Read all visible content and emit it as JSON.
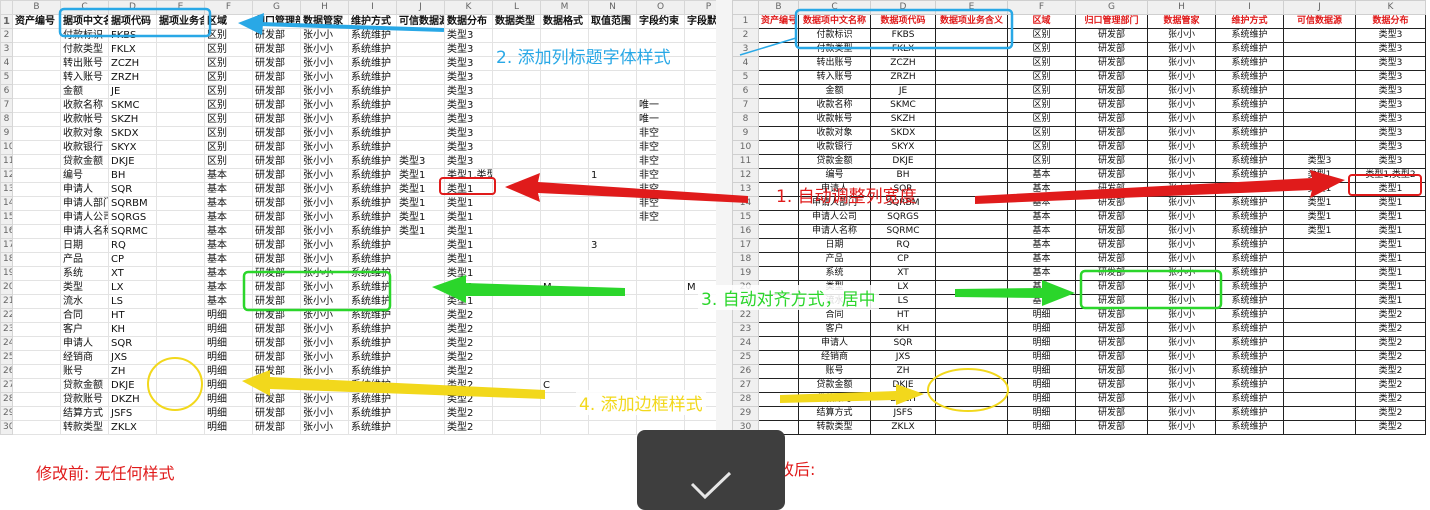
{
  "col_letters_before": [
    "",
    "B",
    "C",
    "D",
    "E",
    "F",
    "G",
    "H",
    "I",
    "J",
    "K",
    "L",
    "M",
    "N",
    "O",
    "P"
  ],
  "col_letters_after": [
    "",
    "B",
    "C",
    "D",
    "E",
    "F",
    "G",
    "H",
    "I",
    "J",
    "K"
  ],
  "headers_before": [
    "资产编号",
    "据项中文名",
    "据项代码",
    "据项业务含义",
    "区域",
    "归口管理部门",
    "数据管家",
    "维护方式",
    "可信数据源",
    "数据分布",
    "数据类型",
    "数据格式",
    "取值范围",
    "字段约束",
    "字段默认"
  ],
  "headers_after": [
    "资产编号",
    "数据项中文名称",
    "数据项代码",
    "数据项业务含义",
    "区域",
    "归口管理部门",
    "数据管家",
    "维护方式",
    "可信数据源",
    "数据分布"
  ],
  "rows": [
    [
      "",
      "付款标识",
      "FKBS",
      "",
      "区别",
      "研发部",
      "张小小",
      "系统维护",
      "",
      "类型3",
      "",
      "",
      "",
      "",
      ""
    ],
    [
      "",
      "付款类型",
      "FKLX",
      "",
      "区别",
      "研发部",
      "张小小",
      "系统维护",
      "",
      "类型3",
      "",
      "",
      "",
      "",
      ""
    ],
    [
      "",
      "转出账号",
      "ZCZH",
      "",
      "区别",
      "研发部",
      "张小小",
      "系统维护",
      "",
      "类型3",
      "",
      "",
      "",
      "",
      ""
    ],
    [
      "",
      "转入账号",
      "ZRZH",
      "",
      "区别",
      "研发部",
      "张小小",
      "系统维护",
      "",
      "类型3",
      "",
      "",
      "",
      "",
      ""
    ],
    [
      "",
      "金额",
      "JE",
      "",
      "区别",
      "研发部",
      "张小小",
      "系统维护",
      "",
      "类型3",
      "",
      "",
      "",
      "",
      ""
    ],
    [
      "",
      "收款名称",
      "SKMC",
      "",
      "区别",
      "研发部",
      "张小小",
      "系统维护",
      "",
      "类型3",
      "",
      "",
      "",
      "唯一",
      ""
    ],
    [
      "",
      "收款帐号",
      "SKZH",
      "",
      "区别",
      "研发部",
      "张小小",
      "系统维护",
      "",
      "类型3",
      "",
      "",
      "",
      "唯一",
      ""
    ],
    [
      "",
      "收款对象",
      "SKDX",
      "",
      "区别",
      "研发部",
      "张小小",
      "系统维护",
      "",
      "类型3",
      "",
      "",
      "",
      "非空",
      ""
    ],
    [
      "",
      "收款银行",
      "SKYX",
      "",
      "区别",
      "研发部",
      "张小小",
      "系统维护",
      "",
      "类型3",
      "",
      "",
      "",
      "非空",
      ""
    ],
    [
      "",
      "贷款金额",
      "DKJE",
      "",
      "区别",
      "研发部",
      "张小小",
      "系统维护",
      "类型3",
      "类型3",
      "",
      "",
      "",
      "非空",
      ""
    ],
    [
      "",
      "编号",
      "BH",
      "",
      "基本",
      "研发部",
      "张小小",
      "系统维护",
      "类型1",
      "类型1,类型2",
      "",
      "",
      "1",
      "非空",
      ""
    ],
    [
      "",
      "申请人",
      "SQR",
      "",
      "基本",
      "研发部",
      "张小小",
      "系统维护",
      "类型1",
      "类型1",
      "",
      "",
      "",
      "非空",
      ""
    ],
    [
      "",
      "申请人部门",
      "SQRBM",
      "",
      "基本",
      "研发部",
      "张小小",
      "系统维护",
      "类型1",
      "类型1",
      "",
      "",
      "",
      "非空",
      ""
    ],
    [
      "",
      "申请人公司",
      "SQRGS",
      "",
      "基本",
      "研发部",
      "张小小",
      "系统维护",
      "类型1",
      "类型1",
      "",
      "",
      "",
      "非空",
      ""
    ],
    [
      "",
      "申请人名称",
      "SQRMC",
      "",
      "基本",
      "研发部",
      "张小小",
      "系统维护",
      "类型1",
      "类型1",
      "",
      "",
      "",
      "",
      ""
    ],
    [
      "",
      "日期",
      "RQ",
      "",
      "基本",
      "研发部",
      "张小小",
      "系统维护",
      "",
      "类型1",
      "",
      "",
      "3",
      "",
      ""
    ],
    [
      "",
      "产品",
      "CP",
      "",
      "基本",
      "研发部",
      "张小小",
      "系统维护",
      "",
      "类型1",
      "",
      "",
      "",
      "",
      ""
    ],
    [
      "",
      "系统",
      "XT",
      "",
      "基本",
      "研发部",
      "张小小",
      "系统维护",
      "",
      "类型1",
      "",
      "",
      "",
      "",
      ""
    ],
    [
      "",
      "类型",
      "LX",
      "",
      "基本",
      "研发部",
      "张小小",
      "系统维护",
      "",
      "类型1",
      "",
      "M",
      "",
      "",
      "M"
    ],
    [
      "",
      "流水",
      "LS",
      "",
      "基本",
      "研发部",
      "张小小",
      "系统维护",
      "",
      "类型1",
      "",
      "",
      "",
      "",
      ""
    ],
    [
      "",
      "合同",
      "HT",
      "",
      "明细",
      "研发部",
      "张小小",
      "系统维护",
      "",
      "类型2",
      "",
      "",
      "",
      "",
      ""
    ],
    [
      "",
      "客户",
      "KH",
      "",
      "明细",
      "研发部",
      "张小小",
      "系统维护",
      "",
      "类型2",
      "",
      "",
      "",
      "",
      ""
    ],
    [
      "",
      "申请人",
      "SQR",
      "",
      "明细",
      "研发部",
      "张小小",
      "系统维护",
      "",
      "类型2",
      "",
      "",
      "",
      "",
      ""
    ],
    [
      "",
      "经销商",
      "JXS",
      "",
      "明细",
      "研发部",
      "张小小",
      "系统维护",
      "",
      "类型2",
      "",
      "",
      "",
      "",
      ""
    ],
    [
      "",
      "账号",
      "ZH",
      "",
      "明细",
      "研发部",
      "张小小",
      "系统维护",
      "",
      "类型2",
      "",
      "",
      "",
      "",
      ""
    ],
    [
      "",
      "贷款金额",
      "DKJE",
      "",
      "明细",
      "研发部",
      "张小小",
      "系统维护",
      "",
      "类型2",
      "",
      "C",
      "",
      "",
      ""
    ],
    [
      "",
      "贷款账号",
      "DKZH",
      "",
      "明细",
      "研发部",
      "张小小",
      "系统维护",
      "",
      "类型2",
      "",
      "",
      "",
      "",
      ""
    ],
    [
      "",
      "结算方式",
      "JSFS",
      "",
      "明细",
      "研发部",
      "张小小",
      "系统维护",
      "",
      "类型2",
      "",
      "",
      "",
      "",
      ""
    ],
    [
      "",
      "转款类型",
      "ZKLX",
      "",
      "明细",
      "研发部",
      "张小小",
      "系统维护",
      "",
      "类型2",
      "",
      "",
      "",
      "",
      ""
    ]
  ],
  "annotations": {
    "step1": "1. 自动调整列宽度",
    "step2": "2. 添加列标题字体样式",
    "step3": "3. 自动对齐方式，居中",
    "step4": "4. 添加边框样式"
  },
  "captions": {
    "before": "修改前: 无任何样式",
    "after": "修改后:"
  },
  "colors": {
    "red": "#e01b1b",
    "blue": "#29a8e6",
    "green": "#2bd62b",
    "yellow": "#f2d81c",
    "dark_tile": "#3e3e3e"
  },
  "icons": {
    "confirm": "checkmark-icon"
  }
}
